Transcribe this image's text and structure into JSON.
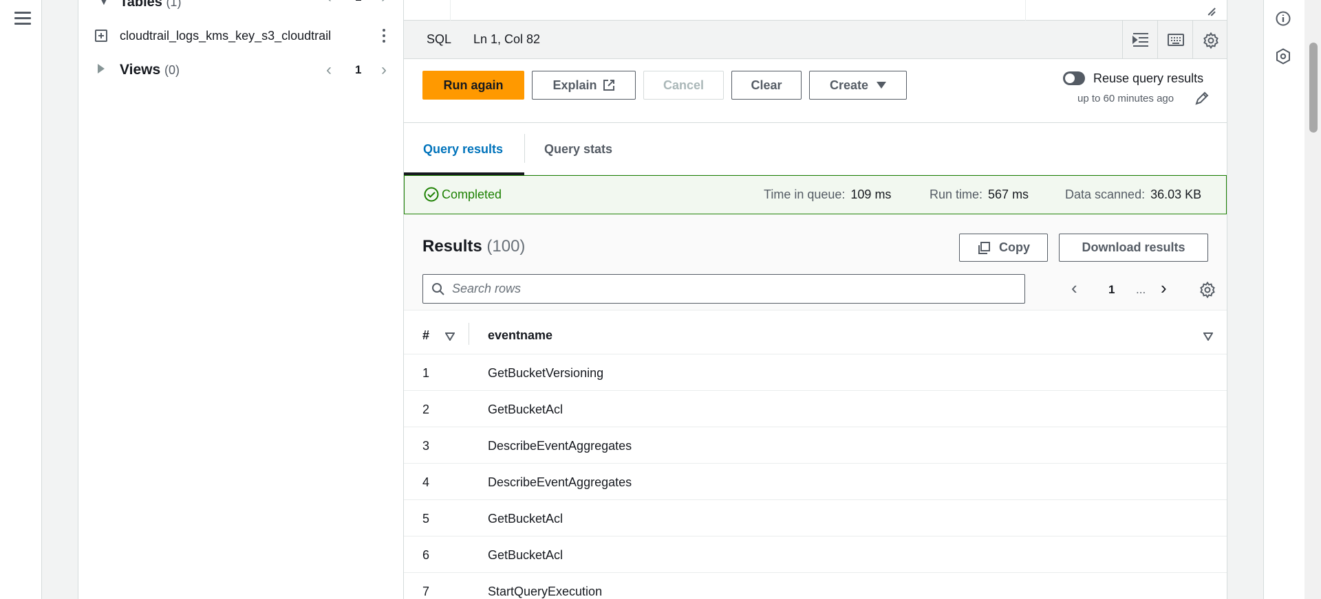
{
  "schema": {
    "tables_label": "Tables",
    "tables_count": "(1)",
    "tables_page": "1",
    "table_name": "cloudtrail_logs_kms_key_s3_cloudtrail",
    "views_label": "Views",
    "views_count": "(0)",
    "views_page": "1"
  },
  "editor": {
    "language": "SQL",
    "cursor_position": "Ln 1, Col 82"
  },
  "toolbar": {
    "run_again": "Run again",
    "explain": "Explain",
    "cancel": "Cancel",
    "clear": "Clear",
    "create": "Create",
    "reuse_label": "Reuse query results",
    "reuse_sub": "up to 60 minutes ago"
  },
  "tabs": {
    "query_results": "Query results",
    "query_stats": "Query stats"
  },
  "status": {
    "state": "Completed",
    "time_in_queue_label": "Time in queue:",
    "time_in_queue": "109 ms",
    "run_time_label": "Run time:",
    "run_time": "567 ms",
    "data_scanned_label": "Data scanned:",
    "data_scanned": "36.03 KB"
  },
  "results": {
    "title": "Results",
    "count": "(100)",
    "copy": "Copy",
    "download": "Download results",
    "search_placeholder": "Search rows",
    "page": "1",
    "ellipsis": "...",
    "columns": [
      "#",
      "eventname"
    ],
    "rows": [
      {
        "idx": "1",
        "eventname": "GetBucketVersioning"
      },
      {
        "idx": "2",
        "eventname": "GetBucketAcl"
      },
      {
        "idx": "3",
        "eventname": "DescribeEventAggregates"
      },
      {
        "idx": "4",
        "eventname": "DescribeEventAggregates"
      },
      {
        "idx": "5",
        "eventname": "GetBucketAcl"
      },
      {
        "idx": "6",
        "eventname": "GetBucketAcl"
      },
      {
        "idx": "7",
        "eventname": "StartQueryExecution"
      }
    ]
  },
  "colors": {
    "primary": "#ff9900",
    "success": "#1d8102",
    "link": "#0073bb"
  },
  "icons": {
    "menu": "hamburger-icon",
    "info": "info-icon",
    "feedback": "hexagon-icon"
  }
}
